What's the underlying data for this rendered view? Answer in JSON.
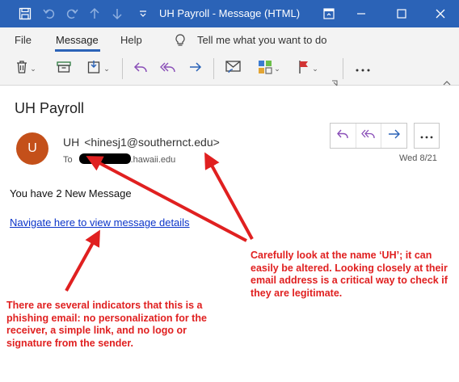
{
  "window": {
    "title": "UH Payroll  -  Message (HTML)"
  },
  "menu": {
    "tabs": [
      "File",
      "Message",
      "Help"
    ],
    "tell_me": "Tell me what you want to do"
  },
  "message": {
    "subject": "UH Payroll",
    "avatar_initial": "U",
    "sender_name": "UH",
    "sender_email": "<hinesj1@southernct.edu>",
    "to_label": "To",
    "to_domain": ".hawaii.edu",
    "date": "Wed 8/21",
    "body_line": "You have 2 New Message",
    "link_text": "Navigate here to view message details"
  },
  "annotations": {
    "right_note": "Carefully look at the name ‘UH’; it can easily be altered. Looking closely at their email address is a critical way to check if they are legitimate.",
    "left_note": "There are several indicators that this is a phishing email: no personalization for the receiver, a simple link, and no logo or signature from the sender."
  },
  "colors": {
    "titlebar": "#2b63b7",
    "avatar": "#c4501a",
    "link": "#0b34c9",
    "annotation": "#e02020"
  }
}
